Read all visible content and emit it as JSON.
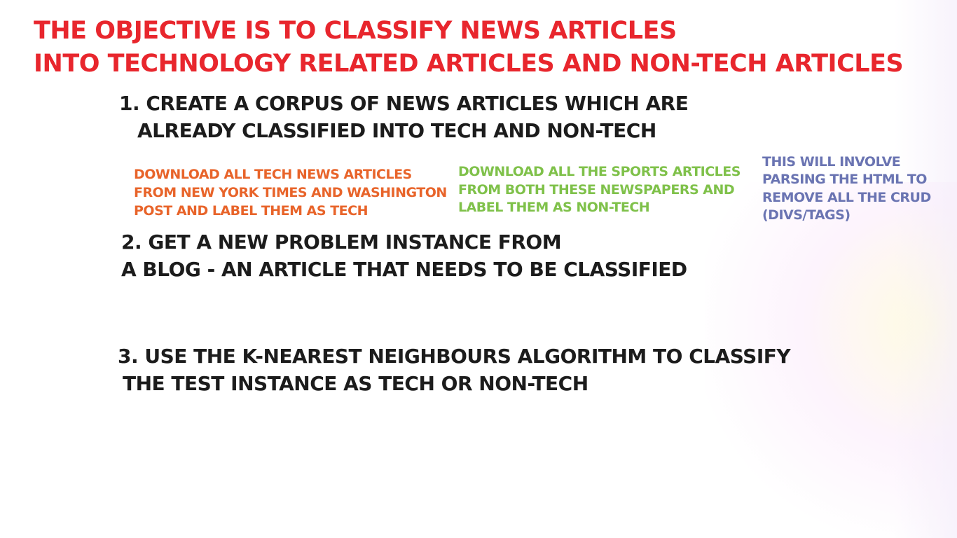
{
  "title": {
    "line1": "THE OBJECTIVE IS TO CLASSIFY NEWS ARTICLES",
    "line2": "INTO TECHNOLOGY RELATED ARTICLES AND NON-TECH ARTICLES",
    "color": "#e8262d"
  },
  "steps": [
    {
      "line1": "1. CREATE A CORPUS OF NEWS ARTICLES WHICH ARE",
      "line2": "ALREADY CLASSIFIED INTO TECH AND NON-TECH"
    },
    {
      "line1": "2. GET A NEW PROBLEM INSTANCE FROM",
      "line2": "A BLOG - AN ARTICLE THAT NEEDS TO BE CLASSIFIED"
    },
    {
      "line1": "3. USE THE K-NEAREST NEIGHBOURS ALGORITHM TO CLASSIFY",
      "line2": "THE TEST INSTANCE AS TECH OR NON-TECH"
    }
  ],
  "notes": {
    "tech": {
      "line1": "DOWNLOAD ALL TECH NEWS ARTICLES",
      "line2": "FROM NEW YORK TIMES AND WASHINGTON",
      "line3": "POST AND LABEL THEM AS TECH",
      "color": "#e8642a"
    },
    "sports": {
      "line1": "DOWNLOAD ALL THE SPORTS ARTICLES",
      "line2": "FROM BOTH THESE NEWSPAPERS AND",
      "line3": "LABEL THEM AS NON-TECH",
      "color": "#7fc14a"
    },
    "parsing": {
      "line1": "THIS WILL INVOLVE",
      "line2": "PARSING THE HTML TO",
      "line3": "REMOVE ALL THE CRUD",
      "line4": "(DIVS/TAGS)",
      "color": "#6a74b2"
    }
  }
}
